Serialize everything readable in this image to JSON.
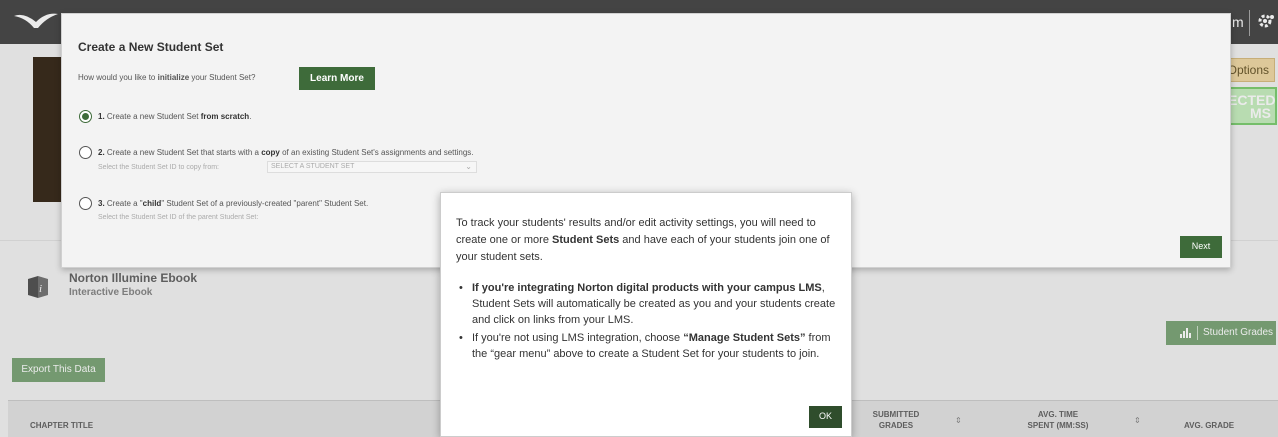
{
  "topbar": {
    "user_text": "m"
  },
  "page": {
    "options_label": "Options",
    "selected_items_label": "ECTED\nMS",
    "ebook_title": "Norton Illumine Ebook",
    "ebook_subtitle": "Interactive Ebook",
    "student_grades_label": "Student Grades",
    "export_label": "Export This Data",
    "table": {
      "col_chapter": "CHAPTER TITLE",
      "col_submitted": "SUBMITTED\nGRADES",
      "col_time": "AVG. TIME\nSPENT (MM:SS)",
      "col_grade": "AVG. GRADE",
      "sort_icon": "⇕"
    }
  },
  "dialog": {
    "title": "Create a New Student Set",
    "question_prefix": "How would you like to ",
    "question_bold": "initialize",
    "question_suffix": " your Student Set?",
    "learn_more_label": "Learn More",
    "option1": {
      "num": "1.",
      "text": " Create a new Student Set ",
      "bold": "from scratch",
      "end": "."
    },
    "option2": {
      "num": "2.",
      "text": " Create a new Student Set that starts with a ",
      "bold": "copy",
      "end": " of an existing Student Set's assignments and settings."
    },
    "option2_sub": "Select the Student Set ID to copy from:",
    "option2_select": "SELECT A STUDENT SET",
    "option3": {
      "num": "3.",
      "text": " Create a \"",
      "bold": "child",
      "end": "\" Student Set of a previously-created \"parent\" Student Set."
    },
    "option3_sub": "Select the Student Set ID of the parent Student Set:",
    "next_label": "Next",
    "selected_option": 1
  },
  "info_popup": {
    "intro_a": "To track your students' results and/or edit activity settings, you will need to create one or more ",
    "intro_bold": "Student Sets",
    "intro_b": " and have each of your students join one of your student sets.",
    "bullet1_bold": "If you're integrating Norton digital products with your campus LMS",
    "bullet1_rest": ", Student Sets will automatically be created as you and your students create and click on links from your LMS.",
    "bullet2_a": "If you're not using LMS integration, choose ",
    "bullet2_bold": "“Manage Student Sets”",
    "bullet2_b": " from the “gear menu” above to create a Student Set for your students to join.",
    "ok_label": "OK"
  }
}
